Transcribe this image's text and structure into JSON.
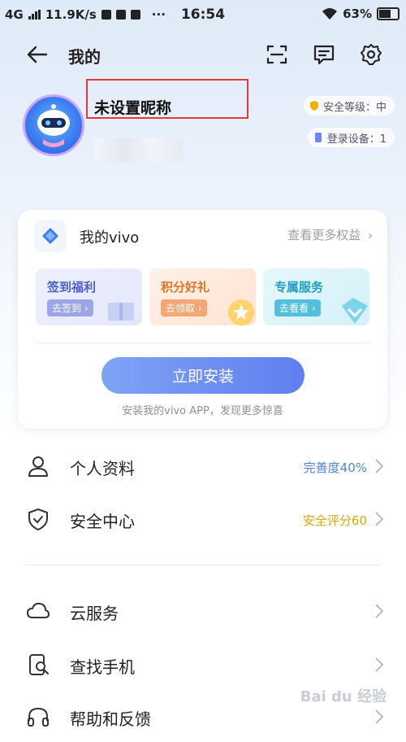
{
  "status_bar": {
    "network": "4G",
    "speed": "11.9K/s",
    "more": "···",
    "time": "16:54",
    "battery": "63%"
  },
  "header": {
    "title": "我的"
  },
  "profile": {
    "nickname": "未设置昵称",
    "security_level": "安全等级：中",
    "login_devices": "登录设备：1"
  },
  "vivo_card": {
    "title": "我的vivo",
    "more_link": "查看更多权益",
    "tiles": [
      {
        "title": "签到福利",
        "action": "去签到"
      },
      {
        "title": "积分好礼",
        "action": "去领取"
      },
      {
        "title": "专属服务",
        "action": "去看看"
      }
    ],
    "install_button": "立即安装",
    "install_hint": "安装我的vivo APP，发现更多惊喜"
  },
  "menu": [
    {
      "label": "个人资料",
      "value": "完善度40%",
      "value_color": "#4a86d8"
    },
    {
      "label": "安全中心",
      "value": "安全评分60",
      "value_color": "#e0a800"
    },
    {
      "label": "云服务",
      "value": ""
    },
    {
      "label": "查找手机",
      "value": ""
    },
    {
      "label": "帮助和反馈",
      "value": ""
    }
  ],
  "colors": {
    "accent": "#5f7ff0",
    "highlight_box": "#e53935"
  },
  "icons": [
    "back-arrow-icon",
    "scan-icon",
    "message-icon",
    "settings-gear-icon",
    "shield-icon",
    "device-icon",
    "user-icon",
    "cloud-icon",
    "find-phone-icon",
    "help-icon",
    "chevron-right-icon"
  ]
}
